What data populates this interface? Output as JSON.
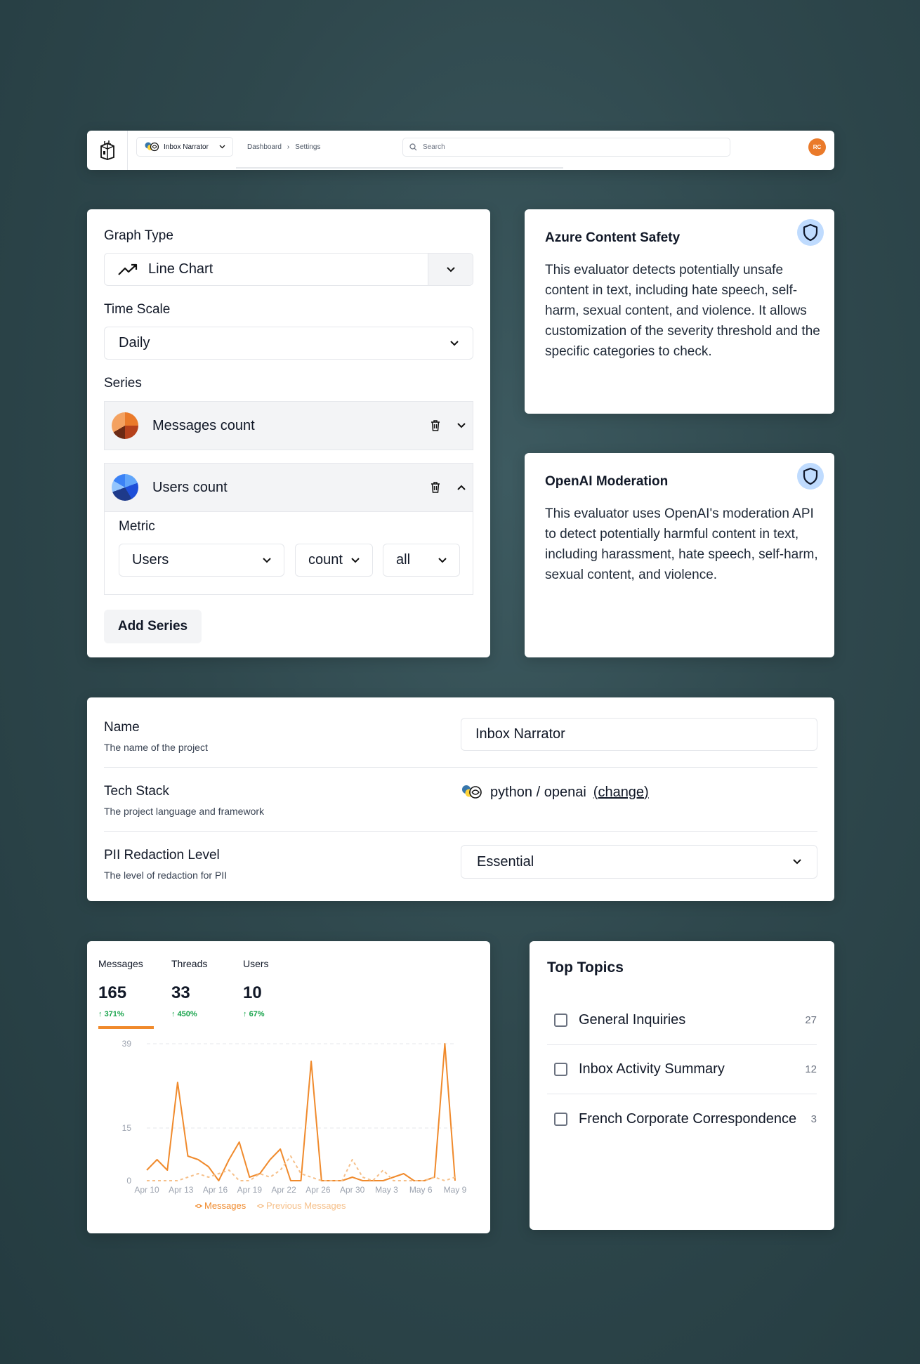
{
  "topbar": {
    "project": "Inbox Narrator",
    "breadcrumb": [
      "Dashboard",
      "Settings"
    ],
    "search_placeholder": "Search",
    "avatar": "RC"
  },
  "graph_builder": {
    "graph_type_label": "Graph Type",
    "graph_type_value": "Line Chart",
    "time_scale_label": "Time Scale",
    "time_scale_value": "Daily",
    "series_label": "Series",
    "series": [
      {
        "name": "Messages count",
        "colors": [
          "#ea7a2a",
          "#f4a261",
          "#b5411c",
          "#6b2a15"
        ]
      },
      {
        "name": "Users count",
        "colors": [
          "#60a5fa",
          "#1d4ed8",
          "#1e3a8a",
          "#93c5fd"
        ]
      }
    ],
    "metric_label": "Metric",
    "metric_field": "Users",
    "metric_agg": "count",
    "metric_filter": "all",
    "add_series": "Add Series"
  },
  "evaluators": [
    {
      "title": "Azure Content Safety",
      "description": "This evaluator detects potentially unsafe content in text, including hate speech, self-harm, sexual content, and violence. It allows customization of the severity threshold and the specific categories to check."
    },
    {
      "title": "OpenAI Moderation",
      "description": "This evaluator uses OpenAI's moderation API to detect potentially harmful content in text, including harassment, hate speech, self-harm, sexual content, and violence."
    }
  ],
  "settings": {
    "name_title": "Name",
    "name_desc": "The name of the project",
    "name_value": "Inbox Narrator",
    "tech_title": "Tech Stack",
    "tech_desc": "The project language and framework",
    "tech_value": "python / openai",
    "tech_change": "(change)",
    "pii_title": "PII Redaction Level",
    "pii_desc": "The level of redaction for PII",
    "pii_value": "Essential"
  },
  "stats": [
    {
      "name": "Messages",
      "value": "165",
      "change": "371%"
    },
    {
      "name": "Threads",
      "value": "33",
      "change": "450%"
    },
    {
      "name": "Users",
      "value": "10",
      "change": "67%"
    }
  ],
  "chart_data": {
    "type": "line",
    "x_ticks": [
      "Apr 10",
      "Apr 13",
      "Apr 16",
      "Apr 19",
      "Apr 22",
      "Apr 26",
      "Apr 30",
      "May 3",
      "May 6",
      "May 9"
    ],
    "y_ticks": [
      0,
      15,
      39
    ],
    "ylim": [
      0,
      39
    ],
    "series": [
      {
        "name": "Messages",
        "color": "#f08a2c",
        "values": [
          3,
          6,
          3,
          28,
          7,
          6,
          4,
          0,
          6,
          11,
          1,
          2,
          6,
          9,
          0,
          0,
          34,
          0,
          0,
          0,
          1,
          0,
          0,
          0,
          1,
          2,
          0,
          0,
          1,
          39,
          0
        ]
      },
      {
        "name": "Previous Messages",
        "color": "#f6c08a",
        "values": [
          0,
          0,
          0,
          0,
          1,
          2,
          1,
          2,
          3,
          0,
          0,
          2,
          1,
          3,
          7,
          2,
          1,
          0,
          0,
          0,
          6,
          1,
          0,
          3,
          0,
          0,
          0,
          0,
          1,
          0,
          1
        ]
      }
    ]
  },
  "topics": {
    "title": "Top Topics",
    "items": [
      {
        "label": "General Inquiries",
        "count": "27"
      },
      {
        "label": "Inbox Activity Summary",
        "count": "12"
      },
      {
        "label": "French Corporate Correspondence",
        "count": "3"
      }
    ]
  }
}
